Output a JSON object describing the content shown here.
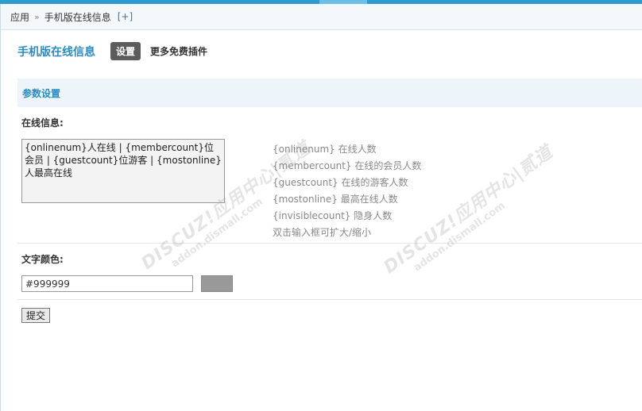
{
  "breadcrumb": {
    "root": "应用",
    "separator": "»",
    "current": "手机版在线信息",
    "add": "[+]"
  },
  "header": {
    "title": "手机版在线信息",
    "tab_active": "设置",
    "tab_more": "更多免费插件"
  },
  "section": {
    "title": "参数设置"
  },
  "online_info": {
    "label": "在线信息:",
    "value": "{onlinenum}人在线 | {membercount}位会员 | {guestcount}位游客 | {mostonline}人最高在线",
    "help": [
      {
        "code": "{onlinenum}",
        "desc": "在线人数"
      },
      {
        "code": "{membercount}",
        "desc": "在线的会员人数"
      },
      {
        "code": "{guestcount}",
        "desc": "在线的游客人数"
      },
      {
        "code": "{mostonline}",
        "desc": "最高在线人数"
      },
      {
        "code": "{invisiblecount}",
        "desc": "隐身人数"
      }
    ],
    "hint": "双击输入框可扩大/缩小"
  },
  "text_color": {
    "label": "文字颜色:",
    "value": "#999999"
  },
  "submit": {
    "label": "提交"
  },
  "watermark": {
    "brand": "DISCUZ!应用中心|贰道",
    "url": "addon.dismall.com"
  },
  "colors": {
    "accent": "#2b8cc4",
    "stripe": "#2b9bd0",
    "swatch": "#999999"
  }
}
